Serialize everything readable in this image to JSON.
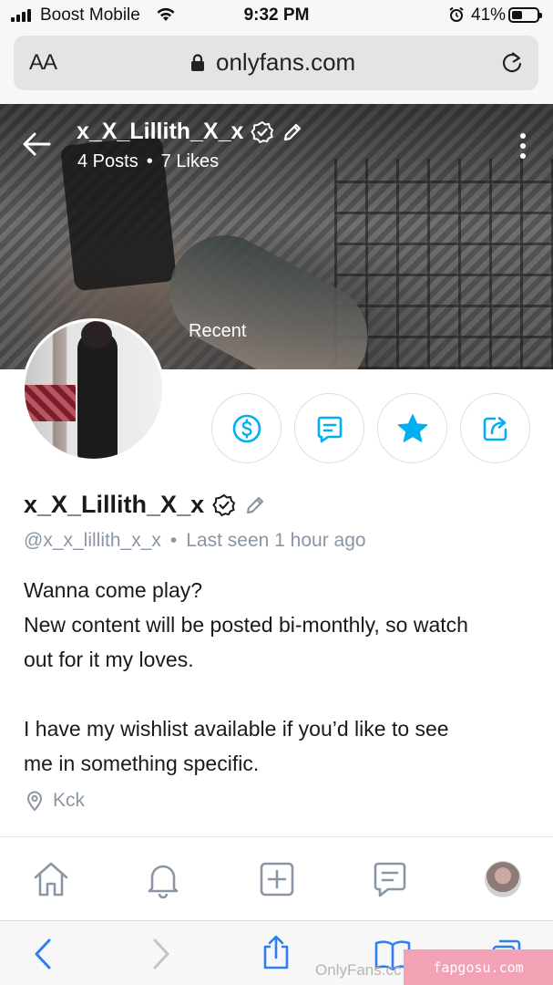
{
  "status_bar": {
    "carrier": "Boost Mobile",
    "time": "9:32 PM",
    "battery_percent": "41%",
    "battery_level": 0.41
  },
  "browser": {
    "text_size_label": "AA",
    "url": "onlyfans.com"
  },
  "header": {
    "name": "x_X_Lillith_X_x",
    "posts": "4 Posts",
    "likes": "7 Likes",
    "separator": "•",
    "cover_label": "Recent"
  },
  "profile": {
    "name": "x_X_Lillith_X_x",
    "handle": "@x_x_lillith_x_x",
    "separator": "•",
    "last_seen": "Last seen 1 hour ago",
    "bio_lines": [
      "Wanna come play?",
      "New content will be posted bi-monthly, so watch",
      "out for it my loves.",
      "",
      "I have my wishlist available if you’d like to see",
      "me in something specific."
    ],
    "location": "Kck"
  },
  "actions": [
    {
      "name": "tip-button",
      "icon": "dollar-icon"
    },
    {
      "name": "message-button",
      "icon": "chat-icon"
    },
    {
      "name": "favorite-button",
      "icon": "star-icon"
    },
    {
      "name": "share-button",
      "icon": "share-icon"
    }
  ],
  "tab_bar": [
    "home-icon",
    "bell-icon",
    "add-icon",
    "messages-icon",
    "profile-avatar"
  ],
  "browser_bottom": {
    "watermark": "OnlyFans.cc",
    "badge": "fapgosu.com"
  },
  "colors": {
    "accent": "#00aff0",
    "muted": "#8a96a3",
    "icon_gray": "#8a96a3",
    "ios_blue": "#2f7ff0"
  }
}
